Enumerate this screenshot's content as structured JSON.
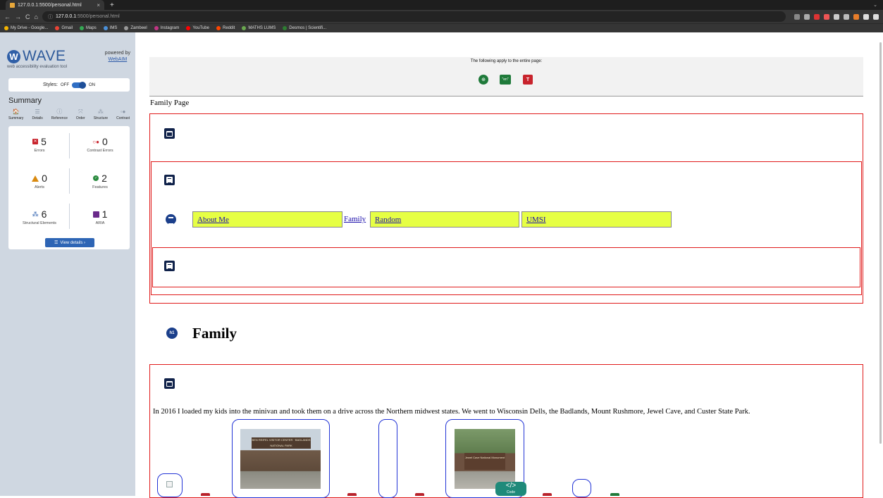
{
  "browser": {
    "tab_title": "127.0.0.1:5500/personal.html",
    "tab_close": "×",
    "new_tab": "+",
    "url_host": "127.0.0.1",
    "url_path": ":5500/personal.html",
    "nav_back": "←",
    "nav_forward": "→",
    "nav_reload": "C",
    "nav_home": "⌂",
    "url_info": "ⓘ",
    "bookmarks": [
      {
        "label": "My Drive - Google...",
        "color": "#f4b400"
      },
      {
        "label": "Gmail",
        "color": "#ea4335"
      },
      {
        "label": "Maps",
        "color": "#34a853"
      },
      {
        "label": "IMS",
        "color": "#4a90d9"
      },
      {
        "label": "Zambeel",
        "color": "#999999"
      },
      {
        "label": "Instagram",
        "color": "#c13584"
      },
      {
        "label": "YouTube",
        "color": "#ff0000"
      },
      {
        "label": "Reddit",
        "color": "#ff4500"
      },
      {
        "label": "MATHS LUMS",
        "color": "#6aa84f"
      },
      {
        "label": "Desmos | Scientifi...",
        "color": "#2e7d32"
      }
    ]
  },
  "wave": {
    "logo_letter": "W",
    "logo_text": "WAVE",
    "tagline": "web accessibility evaluation tool",
    "powered_by": "powered by",
    "webaim": "WebAIM",
    "styles_label": "Styles:",
    "styles_off": "OFF",
    "styles_on": "ON",
    "summary_title": "Summary",
    "tabs": [
      {
        "label": "Summary",
        "icon": "home-icon",
        "glyph": "🏠"
      },
      {
        "label": "Details",
        "icon": "list-icon",
        "glyph": "☰"
      },
      {
        "label": "Reference",
        "icon": "info-icon",
        "glyph": "ⓘ"
      },
      {
        "label": "Order",
        "icon": "order-icon",
        "glyph": "⤧"
      },
      {
        "label": "Structure",
        "icon": "structure-icon",
        "glyph": "⁂"
      },
      {
        "label": "Contrast",
        "icon": "contrast-icon",
        "glyph": "◦●"
      }
    ],
    "stats": {
      "errors": {
        "count": "5",
        "label": "Errors"
      },
      "contrast": {
        "count": "0",
        "label": "Contrast Errors"
      },
      "alerts": {
        "count": "0",
        "label": "Alerts"
      },
      "features": {
        "count": "2",
        "label": "Features"
      },
      "structural": {
        "count": "6",
        "label": "Structural Elements"
      },
      "aria": {
        "count": "1",
        "label": "ARIA"
      }
    },
    "view_details": "View details ›"
  },
  "page": {
    "applies_text": "The following apply to the entire page:",
    "lang_badge": "\"en\"",
    "page_title": "Family Page",
    "nav_links": [
      "About Me",
      "Family",
      "Random",
      "UMSI"
    ],
    "heading_badge": "h1",
    "heading": "Family",
    "paragraph": "In 2016 I loaded my kids into the minivan and took them on a drive across the Northern midwest states. We went to Wisconsin Dells, the Badlands, Mount Rushmore, Jewel Cave, and Custer State Park.",
    "photo1_sign": "BEN REIFEL VISITOR CENTER · BADLANDS NATIONAL PARK",
    "photo2_sign": "Jewel Cave National Monument",
    "code_badge": "</>",
    "code_label": "Code"
  },
  "colors": {
    "error_red": "#e01b1b",
    "image_blue": "#2234d6",
    "wave_blue": "#2e5a9a",
    "link_highlight": "#e6ff44"
  }
}
